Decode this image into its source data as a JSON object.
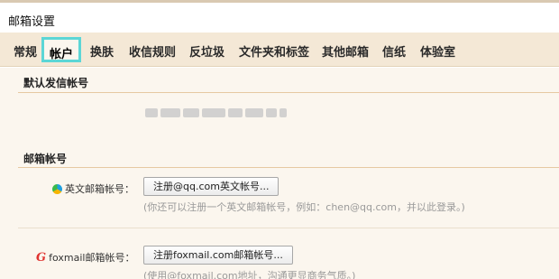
{
  "header": {
    "title": "邮箱设置"
  },
  "tabs": [
    {
      "label": "常规"
    },
    {
      "label": "帐户"
    },
    {
      "label": "换肤"
    },
    {
      "label": "收信规则"
    },
    {
      "label": "反垃圾"
    },
    {
      "label": "文件夹和标签"
    },
    {
      "label": "其他邮箱"
    },
    {
      "label": "信纸"
    },
    {
      "label": "体验室"
    }
  ],
  "default_sender": {
    "title": "默认发信帐号"
  },
  "mail_accounts": {
    "title": "邮箱帐号",
    "english": {
      "icon": "qq-icon",
      "label": "英文邮箱帐号：",
      "button": "注册@qq.com英文帐号...",
      "hint": "(你还可以注册一个英文邮箱帐号，例如：chen@qq.com，并以此登录。)"
    },
    "foxmail": {
      "icon": "foxmail-icon",
      "label": "foxmail邮箱帐号：",
      "button": "注册foxmail.com邮箱帐号...",
      "hint": "(使用@foxmail.com地址，沟通更显商务气质。)"
    }
  },
  "colors": {
    "tabbar_bg": "#f4e8d6",
    "active_tab_border": "#5cd6d6",
    "section_line": "#e6c9a2",
    "content_bg": "#fbf6ee"
  }
}
